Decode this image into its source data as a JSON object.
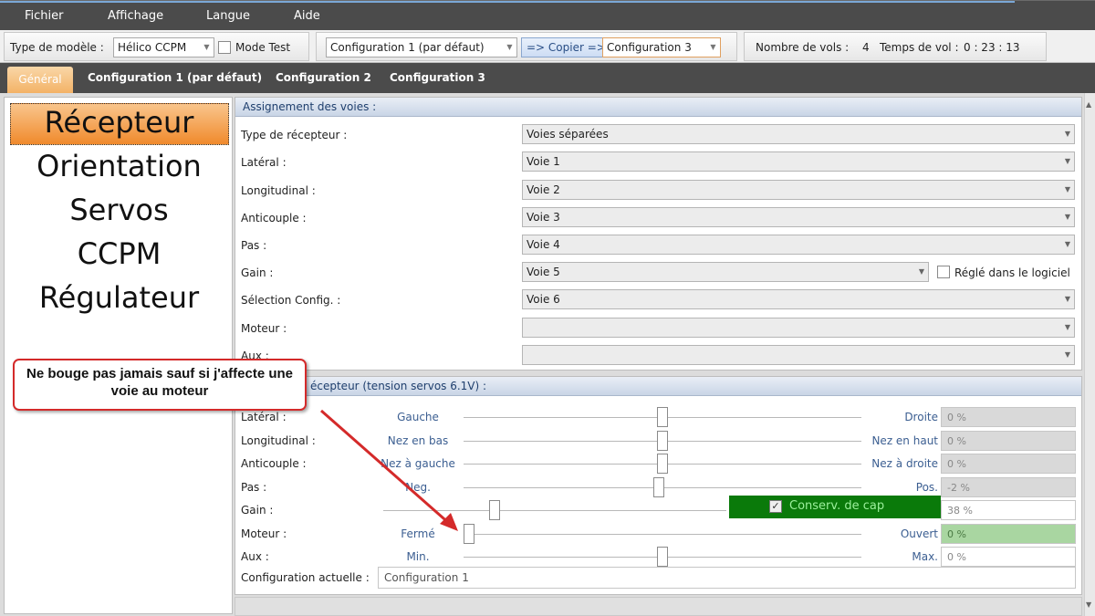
{
  "menu": {
    "items": [
      "Fichier",
      "Affichage",
      "Langue",
      "Aide"
    ]
  },
  "toolbar": {
    "model_type_label": "Type de modèle :",
    "model_type_value": "Hélico CCPM",
    "mode_test_label": "Mode Test",
    "config_source_value": "Configuration 1 (par défaut)",
    "copy_button": "=> Copier =>",
    "config_target_value": "Configuration 3",
    "flights_label": "Nombre de vols :",
    "flights_value": "4",
    "flight_time_label": "Temps de vol :",
    "flight_time_value": "0 : 23 : 13"
  },
  "tabs": [
    "Général",
    "Configuration 1 (par défaut)",
    "Configuration 2",
    "Configuration 3"
  ],
  "sidebar": {
    "items": [
      "Récepteur",
      "Orientation",
      "Servos",
      "CCPM",
      "Régulateur"
    ],
    "active": "Récepteur"
  },
  "assignment": {
    "title": "Assignement des voies :",
    "rows": [
      {
        "label": "Type de récepteur :",
        "value": "Voies séparées"
      },
      {
        "label": "Latéral :",
        "value": "Voie 1"
      },
      {
        "label": "Longitudinal :",
        "value": "Voie 2"
      },
      {
        "label": "Anticouple :",
        "value": "Voie 3"
      },
      {
        "label": "Pas :",
        "value": "Voie 4"
      },
      {
        "label": "Gain :",
        "value": "Voie 5"
      },
      {
        "label": "Sélection Config. :",
        "value": "Voie 6"
      },
      {
        "label": "Moteur :",
        "value": ""
      },
      {
        "label": "Aux :",
        "value": ""
      }
    ],
    "gain_checkbox_label": "Réglé dans le logiciel"
  },
  "receiver": {
    "title": "écepteur (tension servos 6.1V) :",
    "rows": [
      {
        "label": "Latéral :",
        "left": "Gauche",
        "right": "Droite",
        "value": "0 %",
        "position": 0.5
      },
      {
        "label": "Longitudinal :",
        "left": "Nez en bas",
        "right": "Nez en haut",
        "value": "0 %",
        "position": 0.5
      },
      {
        "label": "Anticouple :",
        "left": "Nez à gauche",
        "right": "Nez à droite",
        "value": "0 %",
        "position": 0.5
      },
      {
        "label": "Pas :",
        "left": "Neg.",
        "right": "Pos.",
        "value": "-2 %",
        "position": 0.49
      },
      {
        "label": "Gain :",
        "left": "",
        "right": "",
        "value": "38 %",
        "position": 0.32
      },
      {
        "label": "Moteur :",
        "left": "Fermé",
        "right": "Ouvert",
        "value": "0 %",
        "position": 0.0
      },
      {
        "label": "Aux :",
        "left": "Min.",
        "right": "Max.",
        "value": "0 %",
        "position": 0.5
      }
    ],
    "heading_hold_label": "Conserv. de cap",
    "current_config_label": "Configuration actuelle :",
    "current_config_value": "Configuration 1"
  },
  "callout": {
    "text": "Ne bouge pas jamais sauf si j'affecte une voie au moteur"
  },
  "colors": {
    "accent_orange": "#f08a2c",
    "heading_hold_green": "#0a7a0a",
    "motor_value_green": "#a9d6a1",
    "callout_red": "#d42a2a"
  }
}
